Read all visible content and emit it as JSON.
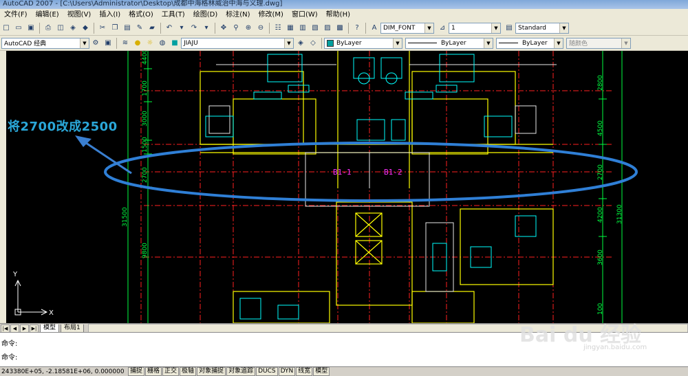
{
  "window": {
    "title": "AutoCAD 2007 - [C:\\Users\\Administrator\\Desktop\\成都中海格林威治中海与义理.dwg]"
  },
  "menu": [
    "文件(F)",
    "编辑(E)",
    "视图(V)",
    "插入(I)",
    "格式(O)",
    "工具(T)",
    "绘图(D)",
    "标注(N)",
    "修改(M)",
    "窗口(W)",
    "帮助(H)"
  ],
  "toolbar": {
    "dim_style": "DIM_FONT",
    "dim_scale": "1",
    "text_style": "Standard",
    "workspace": "AutoCAD 经典",
    "layer": "JIAJU",
    "color": "ByLayer",
    "linetype": "ByLayer",
    "lineweight": "ByLayer",
    "plot_style": "随颜色"
  },
  "drawing": {
    "rooms": [
      "B1-1",
      "B1-2"
    ],
    "left_dims": [
      "4400",
      "1700",
      "3000",
      "1500",
      "2700",
      "31500",
      "9800"
    ],
    "right_dims": [
      "2800",
      "4500",
      "2700",
      "4200",
      "31300",
      "3600",
      "100"
    ],
    "axis_y": "Y",
    "axis_x": "X"
  },
  "annotation": {
    "text": "将2700改成2500"
  },
  "tabs": [
    "模型",
    "布局1"
  ],
  "command": {
    "line1": "命令:",
    "line2": "命令:"
  },
  "status": {
    "coords": "243380E+05, -2.18581E+06, 0.000000",
    "buttons": [
      "捕捉",
      "栅格",
      "正交",
      "极轴",
      "对象捕捉",
      "对象追踪",
      "DUCS",
      "DYN",
      "线宽",
      "模型"
    ]
  },
  "watermark": {
    "brand": "Bai du 经验",
    "url": "jingyan.baidu.com"
  },
  "colors": {
    "canvas": "#000000",
    "wall": "#ffff00",
    "furniture": "#00ffff",
    "dim": "#00ff00",
    "axis": "#ff0000",
    "room_label": "#ff00ff",
    "ellipse": "#2f7fd6"
  }
}
